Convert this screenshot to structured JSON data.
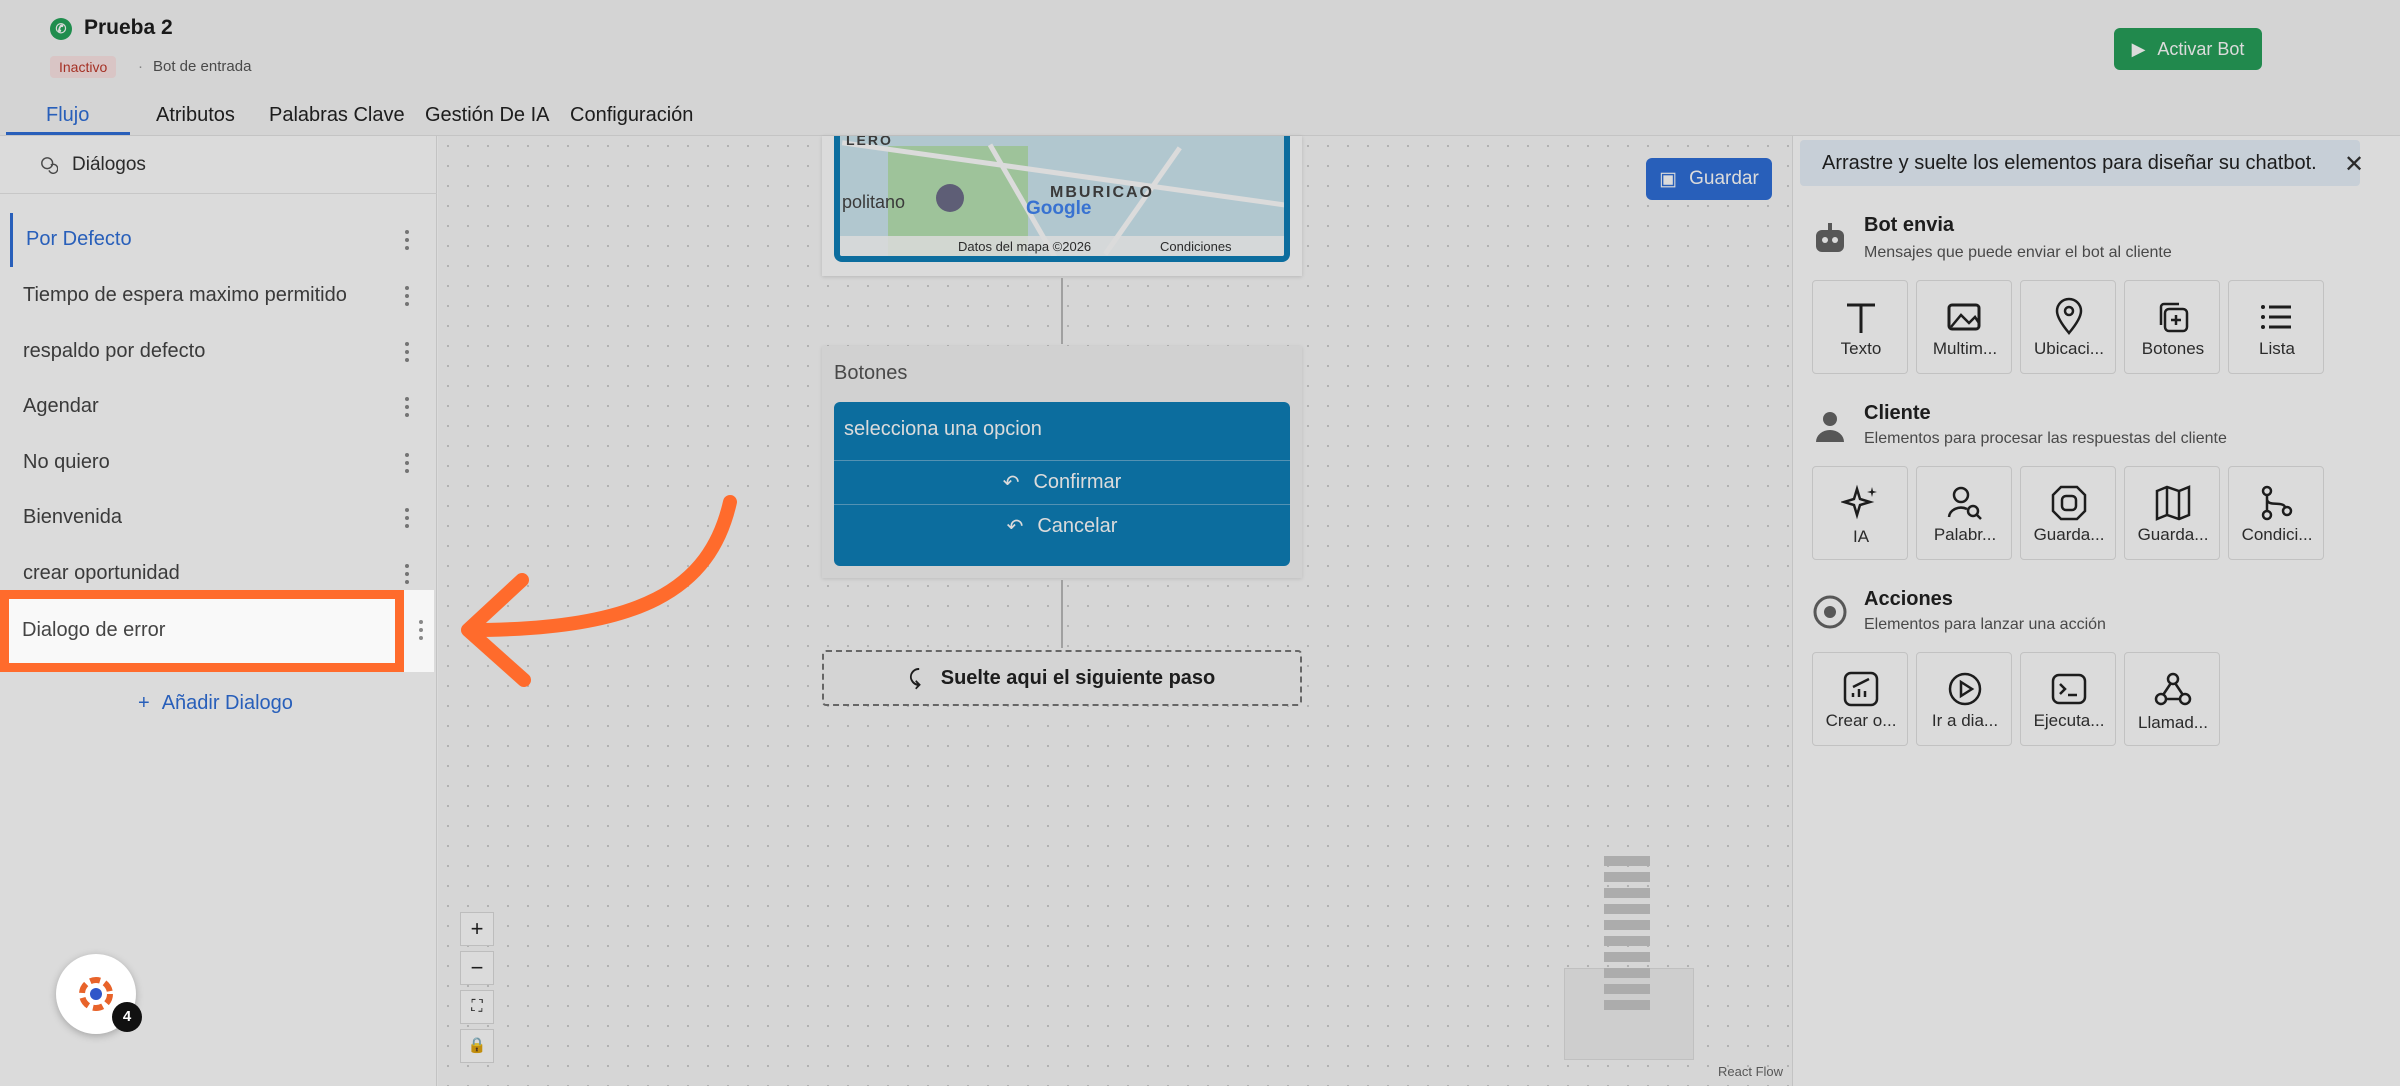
{
  "header": {
    "bot_name": "Prueba 2",
    "status": "Inactivo",
    "bot_type": "Bot de entrada",
    "activate_label": "Activar Bot"
  },
  "tabs": [
    {
      "label": "Flujo",
      "active": true
    },
    {
      "label": "Atributos"
    },
    {
      "label": "Palabras Clave"
    },
    {
      "label": "Gestión De IA"
    },
    {
      "label": "Configuración"
    }
  ],
  "sidebar": {
    "title": "Diálogos",
    "items": [
      {
        "label": "Por Defecto",
        "active": true
      },
      {
        "label": "Tiempo de espera maximo permitido"
      },
      {
        "label": "respaldo por defecto"
      },
      {
        "label": "Agendar"
      },
      {
        "label": "No quiero"
      },
      {
        "label": "Bienvenida"
      },
      {
        "label": "crear oportunidad"
      },
      {
        "label": "Dialogo de error",
        "highlighted": true
      }
    ],
    "add_label": "Añadir Dialogo"
  },
  "canvas": {
    "save_label": "Guardar",
    "map": {
      "label_top": "LERO",
      "label_left": "politano",
      "label_area": "MBURICAO",
      "brand": "Google",
      "map_data": "Datos del mapa ©2026",
      "terms": "Condiciones"
    },
    "buttons_node": {
      "label": "Botones",
      "message": "selecciona una opcion",
      "options": [
        "Confirmar",
        "Cancelar"
      ]
    },
    "drop_label": "Suelte aqui el siguiente paso",
    "attribution": "React Flow",
    "zoom_in": "+",
    "zoom_out": "−"
  },
  "right_panel": {
    "banner": "Arrastre y suelte los elementos para diseñar su chatbot.",
    "sections": [
      {
        "title": "Bot envia",
        "subtitle": "Mensajes que puede enviar el bot al cliente",
        "tiles": [
          "Texto",
          "Multim...",
          "Ubicaci...",
          "Botones",
          "Lista"
        ]
      },
      {
        "title": "Cliente",
        "subtitle": "Elementos para procesar las respuestas del cliente",
        "tiles": [
          "IA",
          "Palabr...",
          "Guarda...",
          "Guarda...",
          "Condici..."
        ]
      },
      {
        "title": "Acciones",
        "subtitle": "Elementos para lanzar una acción",
        "tiles": [
          "Crear o...",
          "Ir a dia...",
          "Ejecuta...",
          "Llamad..."
        ]
      }
    ]
  },
  "fab": {
    "badge": "4"
  },
  "colors": {
    "primary": "#2f6fd9",
    "success": "#27a05a",
    "node_blue": "#0e7fb8",
    "highlight": "#ff6b2c"
  }
}
